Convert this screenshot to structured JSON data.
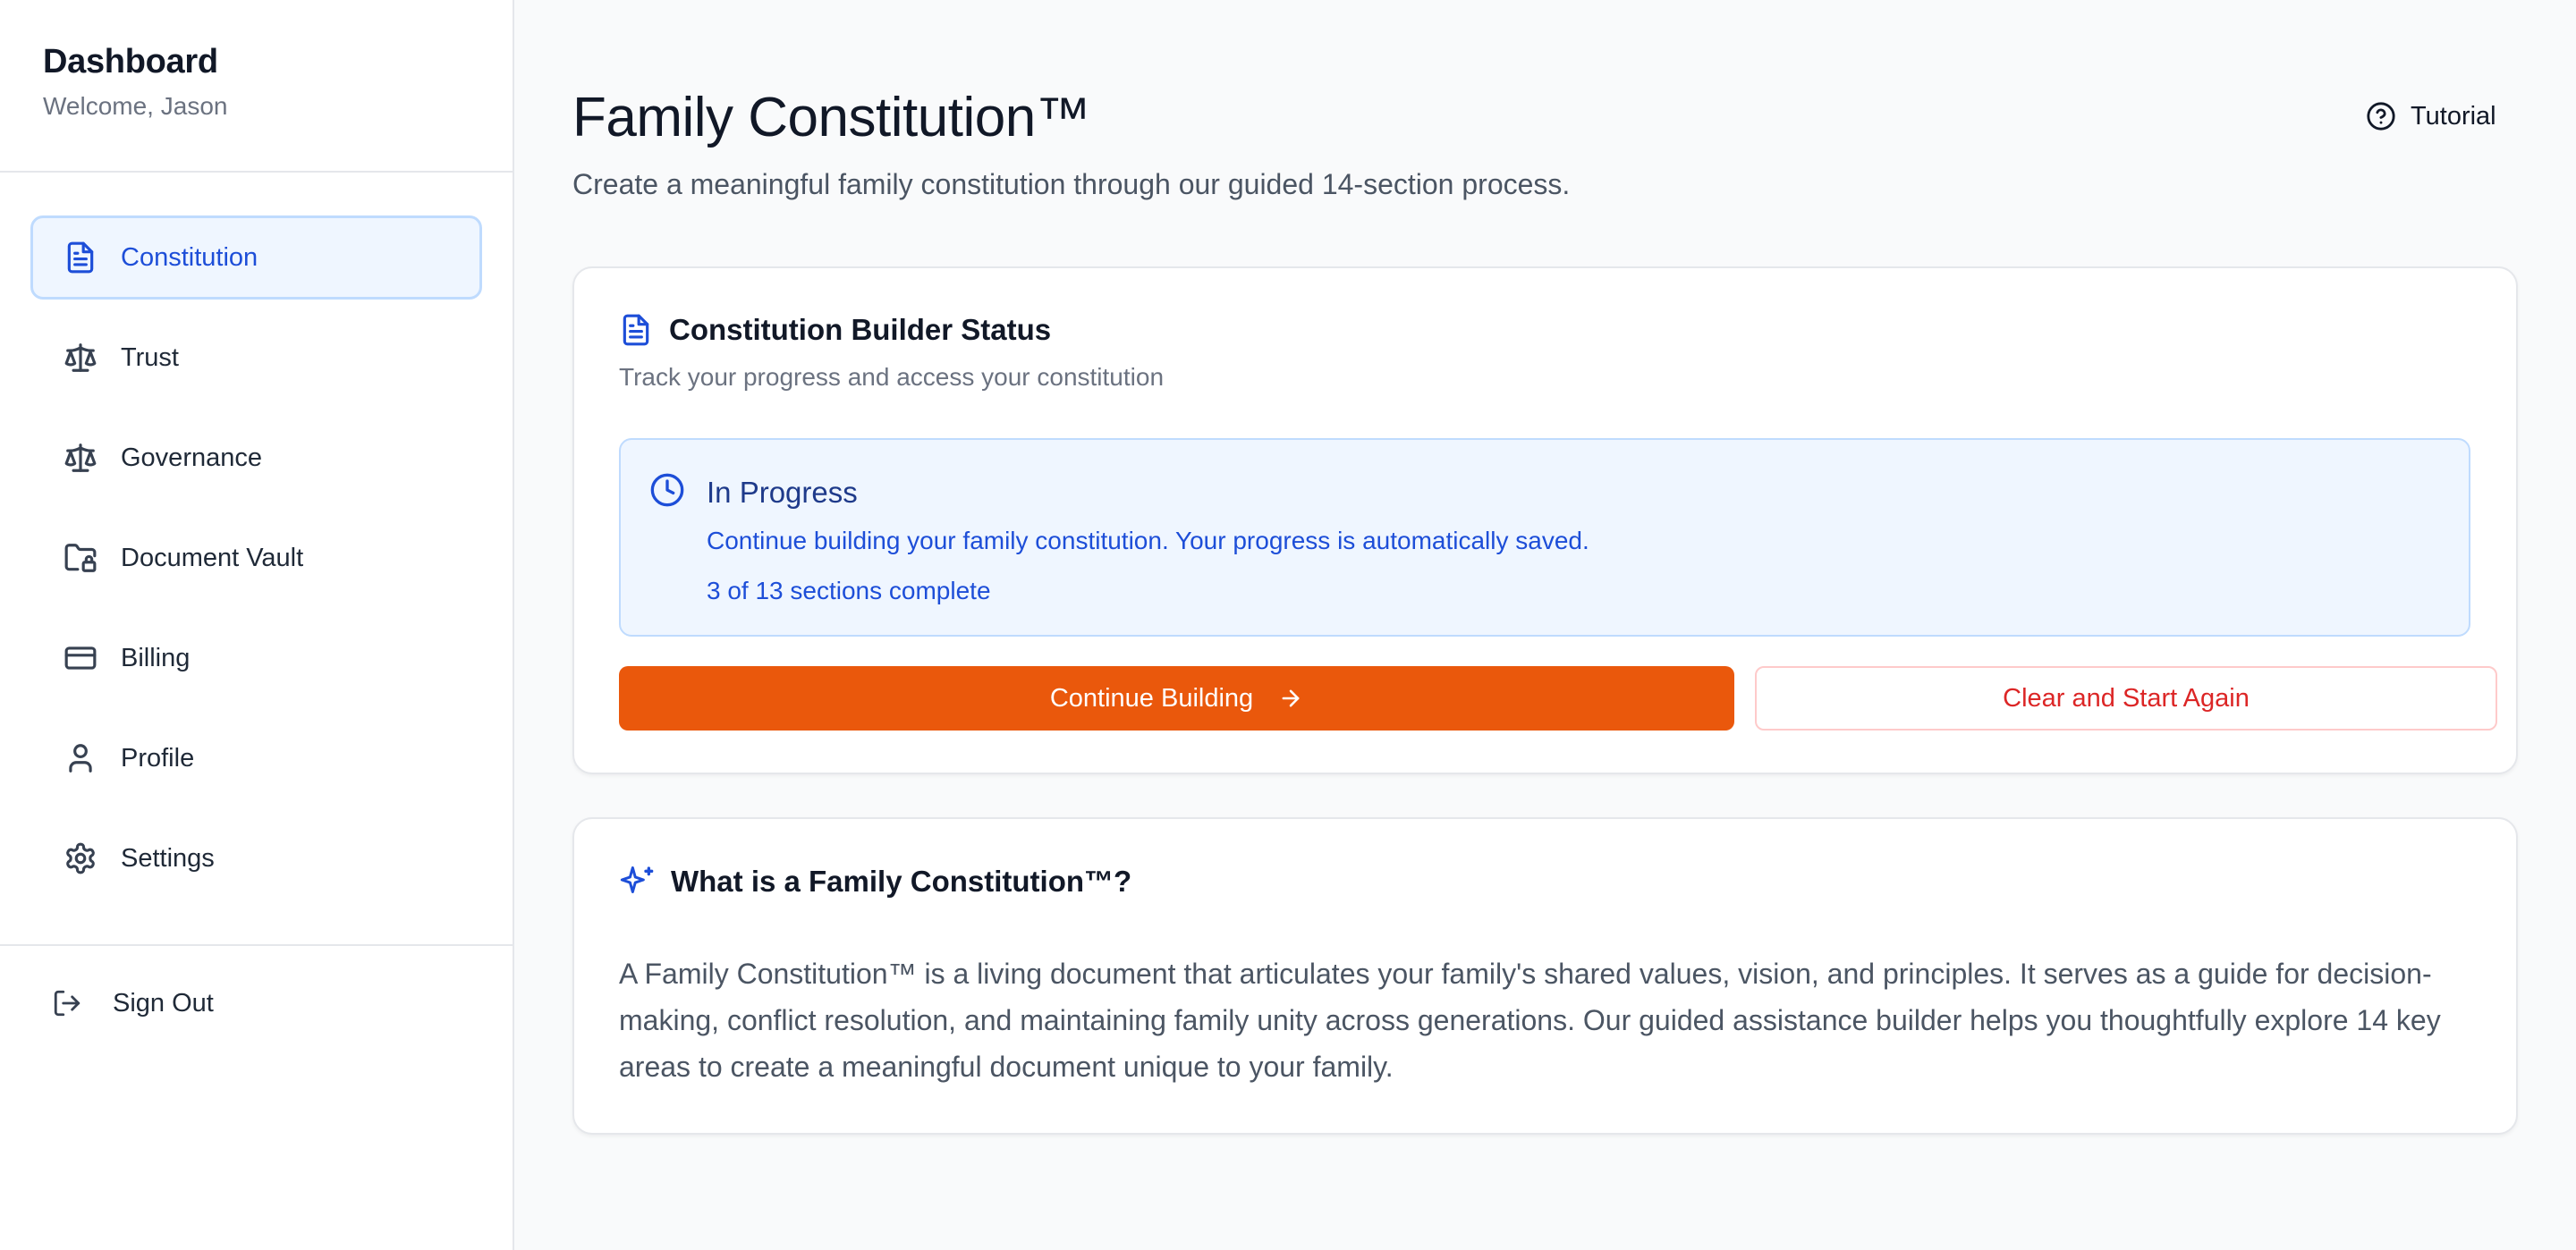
{
  "sidebar": {
    "title": "Dashboard",
    "welcome": "Welcome, Jason",
    "items": [
      {
        "label": "Constitution",
        "icon": "document-icon",
        "active": true
      },
      {
        "label": "Trust",
        "icon": "scale-icon"
      },
      {
        "label": "Governance",
        "icon": "scale-icon"
      },
      {
        "label": "Document Vault",
        "icon": "folder-lock-icon"
      },
      {
        "label": "Billing",
        "icon": "credit-card-icon"
      },
      {
        "label": "Profile",
        "icon": "user-icon"
      },
      {
        "label": "Settings",
        "icon": "gear-icon"
      }
    ],
    "sign_out": "Sign Out"
  },
  "header": {
    "title": "Family Constitution™",
    "subtitle": "Create a meaningful family constitution through our guided 14-section process.",
    "tutorial_label": "Tutorial"
  },
  "status_card": {
    "title": "Constitution Builder Status",
    "subtitle": "Track your progress and access your constitution",
    "status": {
      "title": "In Progress",
      "description": "Continue building your family constitution. Your progress is automatically saved.",
      "count": "3 of 13 sections complete"
    },
    "continue_label": "Continue Building",
    "clear_label": "Clear and Start Again"
  },
  "about_card": {
    "title": "What is a Family Constitution™?",
    "body": "A Family Constitution™ is a living document that articulates your family's shared values, vision, and principles. It serves as a guide for decision-making, conflict resolution, and maintaining family unity across generations. Our guided assistance builder helps you thoughtfully explore 14 key areas to create a meaningful document unique to your family."
  },
  "colors": {
    "accent": "#1d4ed8",
    "primary_button": "#ea580c",
    "danger": "#dc2626",
    "status_bg": "#eff6ff"
  }
}
